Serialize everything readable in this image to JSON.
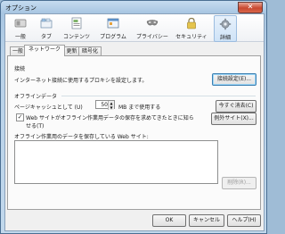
{
  "window": {
    "title": "オプション",
    "close_glyph": "✕"
  },
  "toolbar": {
    "items": [
      {
        "label": "一般",
        "icon": "switch-icon"
      },
      {
        "label": "タブ",
        "icon": "tabs-icon"
      },
      {
        "label": "コンテンツ",
        "icon": "content-icon"
      },
      {
        "label": "プログラム",
        "icon": "applications-icon"
      },
      {
        "label": "プライバシー",
        "icon": "privacy-mask-icon"
      },
      {
        "label": "セキュリティ",
        "icon": "padlock-icon"
      },
      {
        "label": "詳細",
        "icon": "gear-icon",
        "selected": true
      }
    ]
  },
  "subtabs": [
    "一般",
    "ネットワーク",
    "更新",
    "暗号化"
  ],
  "active_subtab": "ネットワーク",
  "connection": {
    "heading": "接続",
    "description": "インターネット接続に使用するプロキシを設定します。",
    "settings_button": "接続設定(E)..."
  },
  "offline": {
    "heading": "オフラインデータ",
    "cache_label": "ページキャッシュとして (U)",
    "cache_value": "50",
    "cache_unit": "MB まで使用する",
    "clear_now_button": "今すぐ消去(C)",
    "notify_label_line1": "Web サイトがオフライン作業用データの保存を求めてきたときに知ら",
    "notify_label_line2": "せる(T)",
    "notify_checked": true,
    "exceptions_button": "例外サイト(X)...",
    "sites_label": "オフライン作業用のデータを保存している Web サイト:",
    "remove_button": "削除(R)..."
  },
  "footer": {
    "ok": "OK",
    "cancel": "キャンセル",
    "help": "ヘルプ(H)"
  },
  "colors": {
    "accent_border": "#3c7fb1",
    "window_frame": "#a7c5e1",
    "close_button": "#c9482f"
  }
}
